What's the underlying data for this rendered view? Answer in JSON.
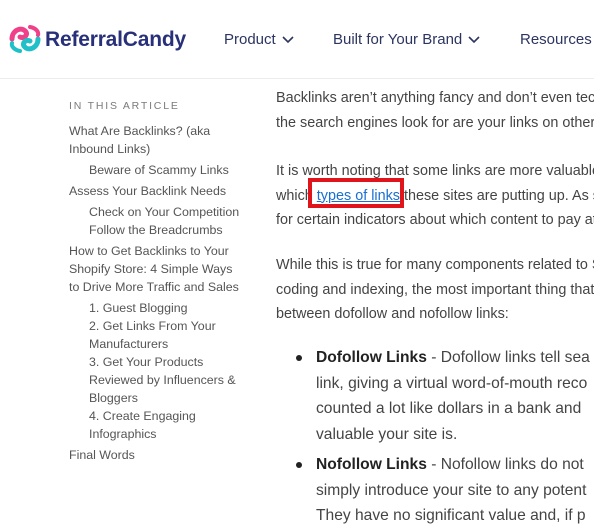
{
  "header": {
    "brand": "ReferralCandy",
    "nav": [
      {
        "label": "Product"
      },
      {
        "label": "Built for Your Brand"
      },
      {
        "label": "Resources"
      }
    ]
  },
  "toc": {
    "heading": "IN THIS ARTICLE",
    "items": [
      {
        "label": "What Are Backlinks? (aka Inbound Links)"
      },
      {
        "label": "Beware of Scammy Links"
      },
      {
        "label": "Assess Your Backlink Needs"
      },
      {
        "label": "Check on Your Competition"
      },
      {
        "label": "Follow the Breadcrumbs"
      },
      {
        "label": "How to Get Backlinks to Your Shopify Store: 4 Simple Ways to Drive More Traffic and Sales"
      },
      {
        "label": "1. Guest Blogging"
      },
      {
        "label": "2. Get Links From Your Manufacturers"
      },
      {
        "label": "3. Get Your Products Reviewed by Influencers & Bloggers"
      },
      {
        "label": "4. Create Engaging Infographics"
      },
      {
        "label": "Final Words"
      }
    ]
  },
  "article": {
    "p1_line1": "Backlinks aren’t anything fancy and don’t even tech",
    "p1_line2": "the search engines look for are your links on other s",
    "p2_line1": "It is worth noting that some links are more valuable",
    "p2_line2_before": "which ",
    "p2_link": "types of links",
    "p2_line2_after": " these sites are putting up. As se",
    "p2_line3": "for certain indicators about which content to pay atte",
    "p3_line1": "While this is true for many components related to S",
    "p3_line2": "coding and indexing, the most important thing that y",
    "p3_line3": "between dofollow and nofollow links:",
    "bullets": [
      {
        "title": "Dofollow Links",
        "line1": " - Dofollow links tell sea",
        "line2": "link, giving a virtual word-of-mouth reco",
        "line3": "counted a lot like dollars in a bank and",
        "line4": "valuable your site is."
      },
      {
        "title": "Nofollow Links",
        "line1": " - Nofollow links do not",
        "line2": "simply introduce your site to any potent",
        "line3": "They have no significant value and, if p"
      }
    ]
  },
  "colors": {
    "brand_navy": "#28307a",
    "logo_pink": "#f0408a",
    "logo_teal": "#1fc0c8",
    "link_blue": "#1a6fd0",
    "highlight_red": "#e0151b"
  }
}
